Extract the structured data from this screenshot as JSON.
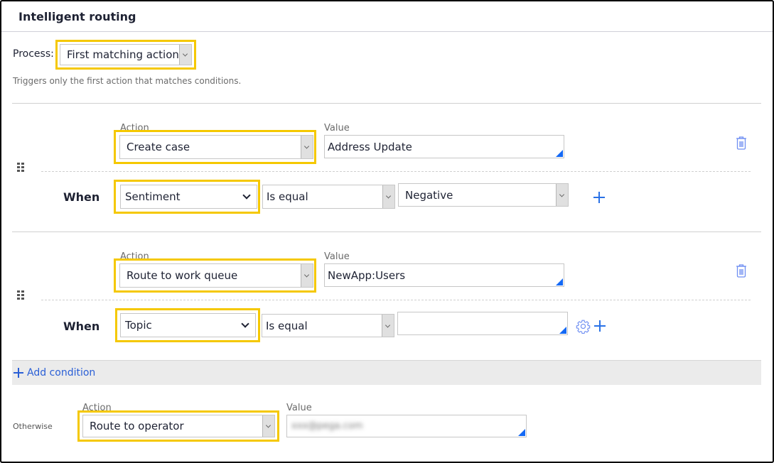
{
  "header": {
    "title": "Intelligent routing"
  },
  "process": {
    "label": "Process:",
    "selected": "First matching action",
    "hint": "Triggers only the first action that matches conditions."
  },
  "rules": [
    {
      "action_label": "Action",
      "action": "Create case",
      "value_label": "Value",
      "value": "Address Update",
      "when_label": "When",
      "condition": {
        "field": "Sentiment",
        "operator": "Is equal",
        "value": "Negative"
      }
    },
    {
      "action_label": "Action",
      "action": "Route to work queue",
      "value_label": "Value",
      "value": "NewApp:Users",
      "when_label": "When",
      "condition": {
        "field": "Topic",
        "operator": "Is equal",
        "value": ""
      }
    }
  ],
  "add_condition": {
    "label": "Add condition"
  },
  "otherwise": {
    "label": "Otherwise",
    "action_label": "Action",
    "action": "Route to operator",
    "value_label": "Value",
    "value": "xxx@pega.com"
  },
  "colors": {
    "highlight": "#f5c800",
    "accent": "#2a72e6",
    "link": "#2a5fd6"
  }
}
